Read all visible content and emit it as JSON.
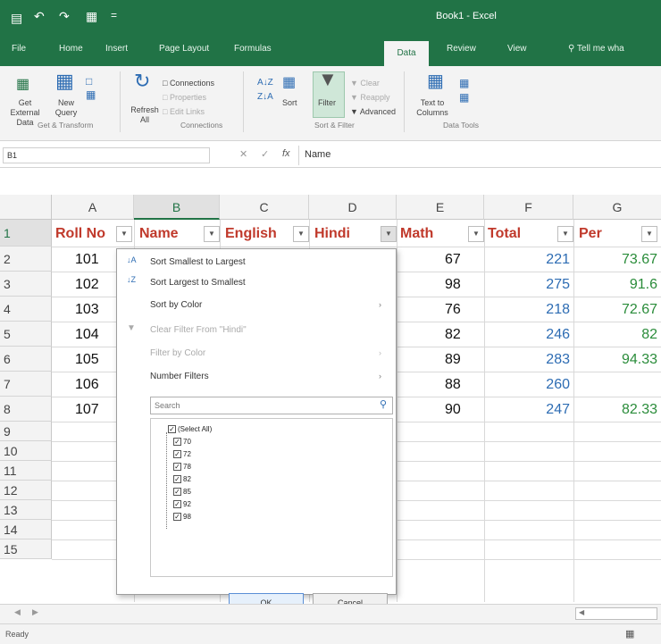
{
  "titlebar": {
    "title": "Book1 - Excel"
  },
  "tabs": [
    "File",
    "Home",
    "Insert",
    "Page Layout",
    "Formulas",
    "Data",
    "Review",
    "View",
    "Tell me wha"
  ],
  "ribbon": {
    "get_external": "Get External Data",
    "new_query": "New Query",
    "get_transform": "Get & Transform",
    "refresh_all": "Refresh All",
    "connections": "Connections",
    "properties": "Properties",
    "edit_links": "Edit Links",
    "connections_group": "Connections",
    "sort": "Sort",
    "filter": "Filter",
    "clear": "Clear",
    "reapply": "Reapply",
    "advanced": "Advanced",
    "sort_filter_group": "Sort & Filter",
    "text_to_columns": "Text to Columns",
    "data_tools_group": "Data Tools"
  },
  "formula_bar": {
    "name_box": "B1",
    "fx": "fx",
    "content": "Name"
  },
  "columns": [
    "A",
    "B",
    "C",
    "D",
    "E",
    "F",
    "G"
  ],
  "rows": [
    "1",
    "2",
    "3",
    "4",
    "5",
    "6",
    "7",
    "8",
    "9",
    "10",
    "11",
    "12",
    "13",
    "14",
    "15"
  ],
  "headers": [
    "Roll No",
    "Name",
    "English",
    "Hindi",
    "Math",
    "Total",
    "Per"
  ],
  "data": {
    "roll": [
      "101",
      "102",
      "103",
      "104",
      "105",
      "106",
      "107"
    ],
    "math": [
      "67",
      "98",
      "76",
      "82",
      "89",
      "88",
      "90"
    ],
    "total": [
      "221",
      "275",
      "218",
      "246",
      "283",
      "260",
      "247"
    ],
    "per": [
      "73.67",
      "91.6",
      "72.67",
      "82",
      "94.33",
      "",
      "82.33"
    ]
  },
  "popup": {
    "sort_asc": "Sort Smallest to Largest",
    "sort_desc": "Sort Largest to Smallest",
    "sort_color": "Sort by Color",
    "clear_filter": "Clear Filter From \"Hindi\"",
    "filter_color": "Filter by Color",
    "number_filters": "Number Filters",
    "search_placeholder": "Search",
    "select_all": "(Select All)",
    "items": [
      "70",
      "72",
      "78",
      "82",
      "85",
      "92",
      "98"
    ],
    "ok": "OK",
    "cancel": "Cancel"
  },
  "status": {
    "ready": "Ready"
  },
  "colors": {
    "excel_green": "#217346",
    "header_red": "#c0392b",
    "value_green": "#2a8c3a",
    "value_blue": "#2d6cb3"
  }
}
